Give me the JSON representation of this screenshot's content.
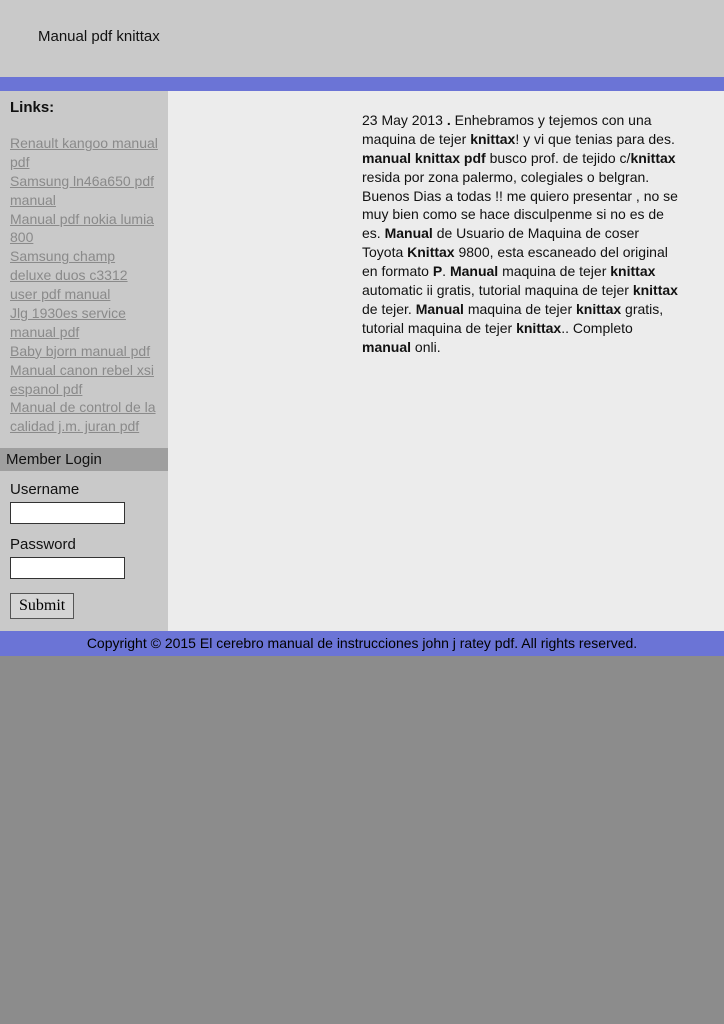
{
  "header": {
    "title": "Manual pdf knittax"
  },
  "sidebar": {
    "links_title": "Links:",
    "links": [
      "Renault kangoo manual pdf",
      "Samsung ln46a650 pdf manual",
      "Manual pdf nokia lumia 800",
      "Samsung champ deluxe duos c3312 user pdf manual",
      "Jlg 1930es service manual pdf",
      "Baby bjorn manual pdf",
      "Manual canon rebel xsi espanol pdf",
      "Manual de control de la calidad j.m. juran pdf"
    ],
    "login": {
      "title": "Member Login",
      "username_label": "Username",
      "password_label": "Password",
      "submit_label": "Submit"
    }
  },
  "article": {
    "date": "23 May 2013 ",
    "t1": " Enhebramos y tejemos con una maquina de tejer ",
    "b1": "knittax",
    "t2": "! y vi que tenias para des. ",
    "b2": "manual knittax pdf",
    "t3": " busco prof. de tejido c/",
    "b3": "knittax",
    "t4": " resida por zona palermo, colegiales o belgran. Buenos Dias a todas !! me quiero presentar , no se muy bien como se hace disculpenme si no es de es. ",
    "b4": "Manual",
    "t5": " de Usuario de Maquina de coser Toyota ",
    "b5": "Knittax",
    "t6": " 9800, esta escaneado del original en formato ",
    "b6": "P",
    "t7": ". ",
    "b7": "Manual",
    "t8": " maquina de tejer ",
    "b8": "knittax",
    "t9": " automatic ii gratis, tutorial maquina de tejer ",
    "b9": "knittax",
    "t10": " de tejer. ",
    "b10": "Manual",
    "t11": " maquina de tejer ",
    "b11": "knittax",
    "t12": " gratis, tutorial maquina de tejer ",
    "b12": "knittax",
    "t13": ".. Completo ",
    "b13": "manual",
    "t14": " onli."
  },
  "footer": {
    "copyright": "Copyright © 2015 El cerebro manual de instrucciones john j ratey pdf. All rights reserved."
  }
}
